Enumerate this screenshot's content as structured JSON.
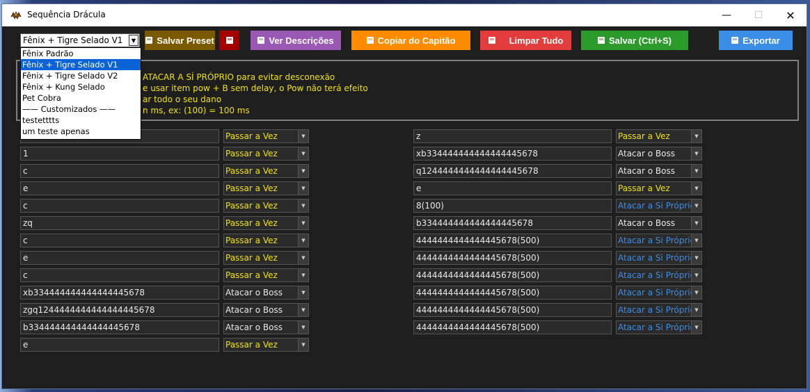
{
  "window": {
    "title": "Sequência Drácula"
  },
  "window_controls": {
    "minimize": "—",
    "maximize": "☐",
    "close": "✕"
  },
  "toolbar": {
    "preset_value": "Fênix + Tigre Selado V1",
    "save_preset": "Salvar Preset",
    "view_descriptions": "Ver Descrições",
    "copy_captain": "Copiar do Capitão",
    "clear_all": "Limpar Tudo",
    "save": "Salvar (Ctrl+S)",
    "export": "Exportar"
  },
  "colors": {
    "save_preset": "#7a5a00",
    "delete_preset": "#a40000",
    "view_descriptions": "#9b59b6",
    "copy_captain": "#ff8c00",
    "clear_all": "#e33c3c",
    "save": "#2a9a2a",
    "export": "#3a8ee6",
    "pass_turn_text": "#f2e200",
    "attack_self_text": "#3a8ee6",
    "attack_boss_text": "#e8e8e8"
  },
  "dropdown": {
    "items": [
      "Fênix Padrão",
      "Fênix + Tigre Selado V1",
      "Fênix + Tigre Selado V2",
      "Fênix + Kung Selado",
      "Pet Cobra",
      "—— Customizados ——",
      "testetttts",
      "um teste apenas"
    ],
    "selected_index": 1
  },
  "info": {
    "lines": [
      "ATACAR A SÍ PRÓPRIO para evitar desconexão",
      "e usar item pow + B sem delay, o Pow não terá efeito",
      "ar todo o seu dano",
      "n ms, ex: (100) = 100 ms"
    ]
  },
  "left_rows": [
    {
      "text": "",
      "action": "Passar a Vez"
    },
    {
      "text": "1",
      "action": "Passar a Vez"
    },
    {
      "text": "c",
      "action": "Passar a Vez"
    },
    {
      "text": "e",
      "action": "Passar a Vez"
    },
    {
      "text": "c",
      "action": "Passar a Vez"
    },
    {
      "text": "zq",
      "action": "Passar a Vez"
    },
    {
      "text": "c",
      "action": "Passar a Vez"
    },
    {
      "text": "e",
      "action": "Passar a Vez"
    },
    {
      "text": "c",
      "action": "Passar a Vez"
    },
    {
      "text": "xb334444444444444445678",
      "action": "Atacar o Boss"
    },
    {
      "text": "zgq1244444444444444445678",
      "action": "Atacar o Boss"
    },
    {
      "text": "b334444444444444445678",
      "action": "Atacar o Boss"
    },
    {
      "text": "e",
      "action": "Passar a Vez"
    }
  ],
  "right_rows": [
    {
      "text": "z",
      "action": "Passar a Vez"
    },
    {
      "text": "xb334444444444444445678",
      "action": "Atacar o Boss"
    },
    {
      "text": "q1244444444444444445678",
      "action": "Atacar o Boss"
    },
    {
      "text": "e",
      "action": "Passar a Vez"
    },
    {
      "text": "8(100)",
      "action": "Atacar a Si Próprio"
    },
    {
      "text": "b334444444444444445678",
      "action": "Atacar o Boss"
    },
    {
      "text": "4444444444444445678(500)",
      "action": "Atacar a Si Próprio"
    },
    {
      "text": "4444444444444445678(500)",
      "action": "Atacar a Si Próprio"
    },
    {
      "text": "4444444444444445678(500)",
      "action": "Atacar a Si Próprio"
    },
    {
      "text": "4444444444444445678(500)",
      "action": "Atacar a Si Próprio"
    },
    {
      "text": "4444444444444445678(500)",
      "action": "Atacar a Si Próprio"
    },
    {
      "text": "4444444444444445678(500)",
      "action": "Atacar a Si Próprio"
    }
  ]
}
